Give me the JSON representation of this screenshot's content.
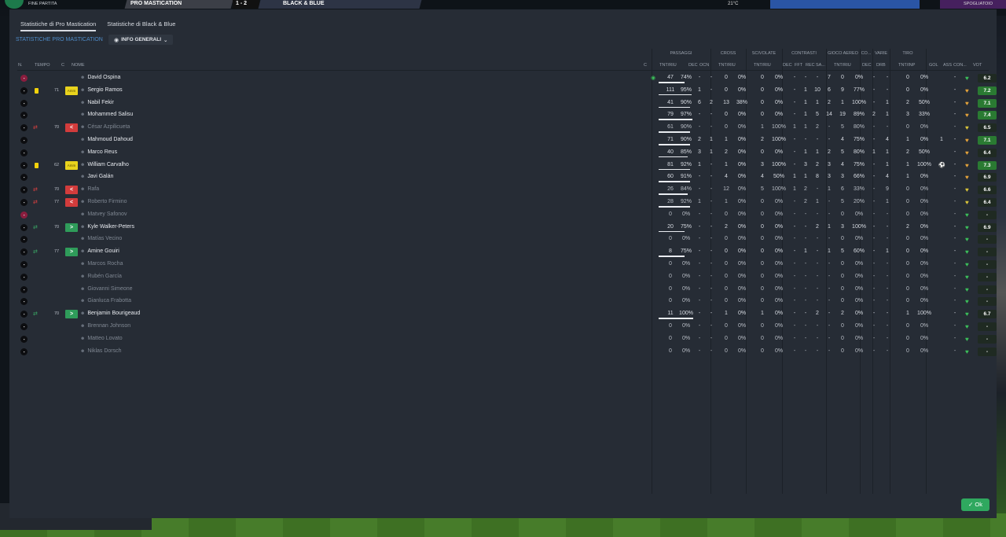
{
  "topbar": {
    "left_label": "FINE PARTITA",
    "home_team": "PRO MASTICATION",
    "score": "1 - 2",
    "away_team": "BLACK & BLUE",
    "temperature": "21°C",
    "right_label": "SPOGLIATOIO"
  },
  "tabs": [
    {
      "label": "Statistiche di Pro Mastication",
      "active": true
    },
    {
      "label": "Statistiche di Black & Blue",
      "active": false
    }
  ],
  "subtitle": "STATISTICHE PRO MASTICATION",
  "view_button": "INFO GENERALI",
  "groups": {
    "passaggi": "PASSAGGI",
    "cross": "CROSS",
    "scivolate": "SCIVOLATE",
    "contrasti": "CONTRASTI",
    "gioco_aereo": "GIOCO AEREO",
    "co": "CO...",
    "varie": "VARIE",
    "tiro": "TIRO"
  },
  "headers": {
    "n": "N.",
    "tempo": "TEMPO",
    "c": "C",
    "nome": "NOME",
    "c2": "C",
    "pass_tnt": "TNT/RIU",
    "pass_dec": "DEC",
    "pass_ocn": "OCN",
    "cross_tnt": "TNT/RIU",
    "sciv_tnt": "TNT/RIU",
    "cont_dec": "DEC",
    "cont_fft": "FFT",
    "cont_rec": "REC",
    "cont_sa": "SA...",
    "aereo_tnt": "TNT/RIU",
    "co_dec": "DEC",
    "varie_drb": "DRB",
    "tiro_tnt": "TNT/INP",
    "gol": "GOL",
    "ass": "ASS",
    "con": "CON...",
    "vot": "VOT"
  },
  "players": [
    {
      "name": "David Ospina",
      "gk": true,
      "yellow": false,
      "sub": "",
      "minute": "",
      "badge": "",
      "extra_icon": "ball",
      "p": "47",
      "pp": "74%",
      "pbar": 0.74,
      "pdec": "-",
      "pocn": "-",
      "cr": "0",
      "crp": "0%",
      "sc": "0",
      "scp": "0%",
      "cdec": "-",
      "cfft": "-",
      "crec": "-",
      "csa": "7",
      "ae": "0",
      "aep": "0%",
      "codec": "-",
      "drb": "-",
      "ti": "0",
      "tip": "0%",
      "gol": "",
      "ass": "-",
      "rating": "6.2",
      "heart": "#3bbf5a",
      "rc": "#1f2a22"
    },
    {
      "name": "Sergio Ramos",
      "gk": false,
      "yellow": true,
      "sub": "",
      "minute": "71",
      "badge": "amm",
      "p": "111",
      "pp": "95%",
      "pbar": 0.95,
      "pdec": "1",
      "pocn": "-",
      "cr": "0",
      "crp": "0%",
      "sc": "0",
      "scp": "0%",
      "cdec": "-",
      "cfft": "1",
      "crec": "10",
      "csa": "6",
      "ae": "9",
      "aep": "77%",
      "codec": "-",
      "drb": "-",
      "ti": "0",
      "tip": "0%",
      "gol": "",
      "ass": "-",
      "rating": "7.2",
      "heart": "#e3a23a",
      "rc": "#2a7a32"
    },
    {
      "name": "Nabil Fekir",
      "gk": false,
      "yellow": false,
      "sub": "",
      "minute": "",
      "badge": "",
      "p": "41",
      "pp": "90%",
      "pbar": 0.9,
      "pdec": "6",
      "pocn": "2",
      "cr": "13",
      "crp": "38%",
      "sc": "0",
      "scp": "0%",
      "cdec": "-",
      "cfft": "1",
      "crec": "1",
      "csa": "2",
      "ae": "1",
      "aep": "100%",
      "codec": "-",
      "drb": "1",
      "ti": "2",
      "tip": "50%",
      "gol": "",
      "ass": "-",
      "rating": "7.1",
      "heart": "#e3a23a",
      "rc": "#2a7a32"
    },
    {
      "name": "Mohammed Salisu",
      "gk": false,
      "yellow": false,
      "sub": "",
      "minute": "",
      "badge": "",
      "p": "79",
      "pp": "97%",
      "pbar": 0.97,
      "pdec": "-",
      "pocn": "-",
      "cr": "0",
      "crp": "0%",
      "sc": "0",
      "scp": "0%",
      "cdec": "-",
      "cfft": "1",
      "crec": "5",
      "csa": "14",
      "ae": "19",
      "aep": "89%",
      "codec": "2",
      "drb": "1",
      "ti": "3",
      "tip": "33%",
      "gol": "",
      "ass": "-",
      "rating": "7.4",
      "heart": "#e3a23a",
      "rc": "#2a7a32"
    },
    {
      "name": "César Azpilicueta",
      "gk": false,
      "yellow": false,
      "sub": "out",
      "minute": "70",
      "badge": "out",
      "muted": true,
      "p": "61",
      "pp": "90%",
      "pbar": 0.9,
      "pdec": "-",
      "pocn": "-",
      "cr": "0",
      "crp": "0%",
      "sc": "1",
      "scp": "100%",
      "cdec": "1",
      "cfft": "1",
      "crec": "2",
      "csa": "-",
      "ae": "5",
      "aep": "80%",
      "codec": "-",
      "drb": "-",
      "ti": "0",
      "tip": "0%",
      "gol": "",
      "ass": "-",
      "rating": "6.5",
      "heart": "#d9c43a",
      "rc": "#1f2a22"
    },
    {
      "name": "Mahmoud Dahoud",
      "gk": false,
      "yellow": false,
      "sub": "",
      "minute": "",
      "badge": "",
      "p": "71",
      "pp": "90%",
      "pbar": 0.9,
      "pdec": "2",
      "pocn": "1",
      "cr": "1",
      "crp": "0%",
      "sc": "2",
      "scp": "100%",
      "cdec": "-",
      "cfft": "-",
      "crec": "-",
      "csa": "-",
      "ae": "4",
      "aep": "75%",
      "codec": "-",
      "drb": "4",
      "ti": "1",
      "tip": "0%",
      "gol": "1",
      "ass": "-",
      "rating": "7.1",
      "heart": "#e3a23a",
      "rc": "#2a7a32"
    },
    {
      "name": "Marco Reus",
      "gk": false,
      "yellow": false,
      "sub": "",
      "minute": "",
      "badge": "",
      "p": "40",
      "pp": "85%",
      "pbar": 0.85,
      "pdec": "3",
      "pocn": "1",
      "cr": "2",
      "crp": "0%",
      "sc": "0",
      "scp": "0%",
      "cdec": "-",
      "cfft": "1",
      "crec": "1",
      "csa": "2",
      "ae": "5",
      "aep": "80%",
      "codec": "1",
      "drb": "1",
      "ti": "2",
      "tip": "50%",
      "gol": "",
      "ass": "-",
      "rating": "6.4",
      "heart": "#e3a23a",
      "rc": "#1f2a22"
    },
    {
      "name": "William Carvalho",
      "gk": false,
      "yellow": true,
      "sub": "",
      "minute": "62",
      "badge": "amm",
      "p": "81",
      "pp": "92%",
      "pbar": 0.92,
      "pdec": "1",
      "pocn": "-",
      "cr": "1",
      "crp": "0%",
      "sc": "3",
      "scp": "100%",
      "cdec": "-",
      "cfft": "3",
      "crec": "2",
      "csa": "3",
      "ae": "4",
      "aep": "75%",
      "codec": "-",
      "drb": "1",
      "ti": "1",
      "tip": "100%",
      "gol": "ball",
      "ass": "-",
      "rating": "7.3",
      "heart": "#e3a23a",
      "rc": "#2a7a32"
    },
    {
      "name": "Javi Galán",
      "gk": false,
      "yellow": false,
      "sub": "",
      "minute": "",
      "badge": "",
      "p": "60",
      "pp": "91%",
      "pbar": 0.91,
      "pdec": "-",
      "pocn": "-",
      "cr": "4",
      "crp": "0%",
      "sc": "4",
      "scp": "50%",
      "cdec": "1",
      "cfft": "1",
      "crec": "8",
      "csa": "3",
      "ae": "3",
      "aep": "66%",
      "codec": "-",
      "drb": "4",
      "ti": "1",
      "tip": "0%",
      "gol": "",
      "ass": "-",
      "rating": "6.9",
      "heart": "#e3a23a",
      "rc": "#1f2a22"
    },
    {
      "name": "Rafa",
      "gk": false,
      "yellow": false,
      "sub": "out",
      "minute": "70",
      "badge": "out",
      "muted": true,
      "p": "26",
      "pp": "84%",
      "pbar": 0.84,
      "pdec": "-",
      "pocn": "-",
      "cr": "12",
      "crp": "0%",
      "sc": "5",
      "scp": "100%",
      "cdec": "1",
      "cfft": "2",
      "crec": "-",
      "csa": "1",
      "ae": "6",
      "aep": "33%",
      "codec": "-",
      "drb": "9",
      "ti": "0",
      "tip": "0%",
      "gol": "",
      "ass": "-",
      "rating": "6.6",
      "heart": "#d9c43a",
      "rc": "#1f2a22"
    },
    {
      "name": "Roberto Firmino",
      "gk": false,
      "yellow": false,
      "sub": "out",
      "minute": "77",
      "badge": "out",
      "muted": true,
      "p": "28",
      "pp": "92%",
      "pbar": 0.92,
      "pdec": "1",
      "pocn": "-",
      "cr": "1",
      "crp": "0%",
      "sc": "0",
      "scp": "0%",
      "cdec": "-",
      "cfft": "2",
      "crec": "1",
      "csa": "-",
      "ae": "5",
      "aep": "20%",
      "codec": "-",
      "drb": "1",
      "ti": "0",
      "tip": "0%",
      "gol": "",
      "ass": "-",
      "rating": "6.4",
      "heart": "#d9c43a",
      "rc": "#1f2a22"
    },
    {
      "name": "Matvey Safonov",
      "gk": true,
      "yellow": false,
      "sub": "",
      "minute": "",
      "badge": "",
      "muted": true,
      "p": "0",
      "pp": "0%",
      "pbar": 0,
      "pdec": "-",
      "pocn": "-",
      "cr": "0",
      "crp": "0%",
      "sc": "0",
      "scp": "0%",
      "cdec": "-",
      "cfft": "-",
      "crec": "-",
      "csa": "-",
      "ae": "0",
      "aep": "0%",
      "codec": "-",
      "drb": "-",
      "ti": "0",
      "tip": "0%",
      "gol": "",
      "ass": "-",
      "rating": "-",
      "heart": "#3bbf5a",
      "rc": "#1f2a22"
    },
    {
      "name": "Kyle Walker-Peters",
      "gk": false,
      "yellow": false,
      "sub": "in",
      "minute": "70",
      "badge": "in",
      "p": "20",
      "pp": "75%",
      "pbar": 0.75,
      "pdec": "-",
      "pocn": "-",
      "cr": "2",
      "crp": "0%",
      "sc": "0",
      "scp": "0%",
      "cdec": "-",
      "cfft": "-",
      "crec": "2",
      "csa": "1",
      "ae": "3",
      "aep": "100%",
      "codec": "-",
      "drb": "-",
      "ti": "2",
      "tip": "0%",
      "gol": "",
      "ass": "-",
      "rating": "6.9",
      "heart": "#3bbf5a",
      "rc": "#1f2a22"
    },
    {
      "name": "Matías Vecino",
      "gk": false,
      "yellow": false,
      "sub": "",
      "minute": "",
      "badge": "",
      "muted": true,
      "p": "0",
      "pp": "0%",
      "pbar": 0,
      "pdec": "-",
      "pocn": "-",
      "cr": "0",
      "crp": "0%",
      "sc": "0",
      "scp": "0%",
      "cdec": "-",
      "cfft": "-",
      "crec": "-",
      "csa": "-",
      "ae": "0",
      "aep": "0%",
      "codec": "-",
      "drb": "-",
      "ti": "0",
      "tip": "0%",
      "gol": "",
      "ass": "-",
      "rating": "-",
      "heart": "#3bbf5a",
      "rc": "#1f2a22"
    },
    {
      "name": "Amine Gouiri",
      "gk": false,
      "yellow": false,
      "sub": "in",
      "minute": "77",
      "badge": "in",
      "p": "8",
      "pp": "75%",
      "pbar": 0.75,
      "pdec": "-",
      "pocn": "-",
      "cr": "0",
      "crp": "0%",
      "sc": "0",
      "scp": "0%",
      "cdec": "-",
      "cfft": "1",
      "crec": "-",
      "csa": "1",
      "ae": "5",
      "aep": "60%",
      "codec": "-",
      "drb": "1",
      "ti": "0",
      "tip": "0%",
      "gol": "",
      "ass": "-",
      "rating": "-",
      "heart": "#3bbf5a",
      "rc": "#1f2a22"
    },
    {
      "name": "Marcos Rocha",
      "gk": false,
      "yellow": false,
      "sub": "",
      "minute": "",
      "badge": "",
      "muted": true,
      "p": "0",
      "pp": "0%",
      "pbar": 0,
      "pdec": "-",
      "pocn": "-",
      "cr": "0",
      "crp": "0%",
      "sc": "0",
      "scp": "0%",
      "cdec": "-",
      "cfft": "-",
      "crec": "-",
      "csa": "-",
      "ae": "0",
      "aep": "0%",
      "codec": "-",
      "drb": "-",
      "ti": "0",
      "tip": "0%",
      "gol": "",
      "ass": "-",
      "rating": "-",
      "heart": "#3bbf5a",
      "rc": "#1f2a22"
    },
    {
      "name": "Rubén García",
      "gk": false,
      "yellow": false,
      "sub": "",
      "minute": "",
      "badge": "",
      "muted": true,
      "p": "0",
      "pp": "0%",
      "pbar": 0,
      "pdec": "-",
      "pocn": "-",
      "cr": "0",
      "crp": "0%",
      "sc": "0",
      "scp": "0%",
      "cdec": "-",
      "cfft": "-",
      "crec": "-",
      "csa": "-",
      "ae": "0",
      "aep": "0%",
      "codec": "-",
      "drb": "-",
      "ti": "0",
      "tip": "0%",
      "gol": "",
      "ass": "-",
      "rating": "-",
      "heart": "#3bbf5a",
      "rc": "#1f2a22"
    },
    {
      "name": "Giovanni Simeone",
      "gk": false,
      "yellow": false,
      "sub": "",
      "minute": "",
      "badge": "",
      "muted": true,
      "p": "0",
      "pp": "0%",
      "pbar": 0,
      "pdec": "-",
      "pocn": "-",
      "cr": "0",
      "crp": "0%",
      "sc": "0",
      "scp": "0%",
      "cdec": "-",
      "cfft": "-",
      "crec": "-",
      "csa": "-",
      "ae": "0",
      "aep": "0%",
      "codec": "-",
      "drb": "-",
      "ti": "0",
      "tip": "0%",
      "gol": "",
      "ass": "-",
      "rating": "-",
      "heart": "#3bbf5a",
      "rc": "#1f2a22"
    },
    {
      "name": "Gianluca Frabotta",
      "gk": false,
      "yellow": false,
      "sub": "",
      "minute": "",
      "badge": "",
      "muted": true,
      "p": "0",
      "pp": "0%",
      "pbar": 0,
      "pdec": "-",
      "pocn": "-",
      "cr": "0",
      "crp": "0%",
      "sc": "0",
      "scp": "0%",
      "cdec": "-",
      "cfft": "-",
      "crec": "-",
      "csa": "-",
      "ae": "0",
      "aep": "0%",
      "codec": "-",
      "drb": "-",
      "ti": "0",
      "tip": "0%",
      "gol": "",
      "ass": "-",
      "rating": "-",
      "heart": "#3bbf5a",
      "rc": "#1f2a22"
    },
    {
      "name": "Benjamin Bourigeaud",
      "gk": false,
      "yellow": false,
      "sub": "in",
      "minute": "70",
      "badge": "in",
      "p": "11",
      "pp": "100%",
      "pbar": 1.0,
      "pdec": "-",
      "pocn": "-",
      "cr": "1",
      "crp": "0%",
      "sc": "1",
      "scp": "0%",
      "cdec": "-",
      "cfft": "-",
      "crec": "2",
      "csa": "-",
      "ae": "2",
      "aep": "0%",
      "codec": "-",
      "drb": "-",
      "ti": "1",
      "tip": "100%",
      "gol": "",
      "ass": "-",
      "rating": "6.7",
      "heart": "#3bbf5a",
      "rc": "#1f2a22"
    },
    {
      "name": "Brennan Johnson",
      "gk": false,
      "yellow": false,
      "sub": "",
      "minute": "",
      "badge": "",
      "muted": true,
      "p": "0",
      "pp": "0%",
      "pbar": 0,
      "pdec": "-",
      "pocn": "-",
      "cr": "0",
      "crp": "0%",
      "sc": "0",
      "scp": "0%",
      "cdec": "-",
      "cfft": "-",
      "crec": "-",
      "csa": "-",
      "ae": "0",
      "aep": "0%",
      "codec": "-",
      "drb": "-",
      "ti": "0",
      "tip": "0%",
      "gol": "",
      "ass": "-",
      "rating": "-",
      "heart": "#3bbf5a",
      "rc": "#1f2a22"
    },
    {
      "name": "Matteo Lovato",
      "gk": false,
      "yellow": false,
      "sub": "",
      "minute": "",
      "badge": "",
      "muted": true,
      "p": "0",
      "pp": "0%",
      "pbar": 0,
      "pdec": "-",
      "pocn": "-",
      "cr": "0",
      "crp": "0%",
      "sc": "0",
      "scp": "0%",
      "cdec": "-",
      "cfft": "-",
      "crec": "-",
      "csa": "-",
      "ae": "0",
      "aep": "0%",
      "codec": "-",
      "drb": "-",
      "ti": "0",
      "tip": "0%",
      "gol": "",
      "ass": "-",
      "rating": "-",
      "heart": "#3bbf5a",
      "rc": "#1f2a22"
    },
    {
      "name": "Niklas Dorsch",
      "gk": false,
      "yellow": false,
      "sub": "",
      "minute": "",
      "badge": "",
      "muted": true,
      "p": "0",
      "pp": "0%",
      "pbar": 0,
      "pdec": "-",
      "pocn": "-",
      "cr": "0",
      "crp": "0%",
      "sc": "0",
      "scp": "0%",
      "cdec": "-",
      "cfft": "-",
      "crec": "-",
      "csa": "-",
      "ae": "0",
      "aep": "0%",
      "codec": "-",
      "drb": "-",
      "ti": "0",
      "tip": "0%",
      "gol": "",
      "ass": "-",
      "rating": "-",
      "heart": "#3bbf5a",
      "rc": "#1f2a22"
    }
  ],
  "badge_labels": {
    "amm": "Amm",
    "out": "<",
    "in": ">"
  },
  "ok_label": "Ok"
}
